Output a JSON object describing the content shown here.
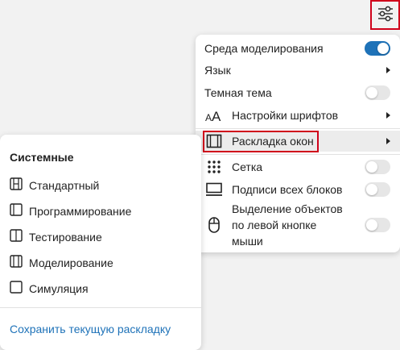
{
  "colors": {
    "accent": "#1e72b8",
    "highlight_border": "#d0021b"
  },
  "settings_button": {
    "icon": "sliders-icon"
  },
  "settings_menu": {
    "items": [
      {
        "label": "Среда моделирования",
        "control": "toggle",
        "checked": true
      },
      {
        "label": "Язык",
        "control": "submenu"
      },
      {
        "label": "Темная тема",
        "control": "toggle",
        "checked": false
      },
      {
        "label": "Настройки шрифтов",
        "icon": "font-size-icon",
        "control": "submenu"
      },
      {
        "label": "Раскладка окон",
        "icon": "window-layout-icon",
        "control": "submenu",
        "active": true
      },
      {
        "label": "Сетка",
        "icon": "grid-dots-icon",
        "control": "toggle",
        "checked": false
      },
      {
        "label": "Подписи всех блоков",
        "icon": "block-caption-icon",
        "control": "toggle",
        "checked": false
      },
      {
        "label_lines": [
          "Выделение объектов",
          "по левой кнопке",
          "мыши"
        ],
        "icon": "mouse-left-icon",
        "control": "toggle",
        "checked": false
      }
    ]
  },
  "layout_panel": {
    "title": "Системные",
    "items": [
      {
        "label": "Стандартный",
        "icon": "layout-standard-icon"
      },
      {
        "label": "Программирование",
        "icon": "layout-programming-icon"
      },
      {
        "label": "Тестирование",
        "icon": "layout-testing-icon"
      },
      {
        "label": "Моделирование",
        "icon": "layout-modeling-icon"
      },
      {
        "label": "Симуляция",
        "icon": "layout-simulation-icon"
      }
    ],
    "save_link": "Сохранить текущую раскладку"
  }
}
